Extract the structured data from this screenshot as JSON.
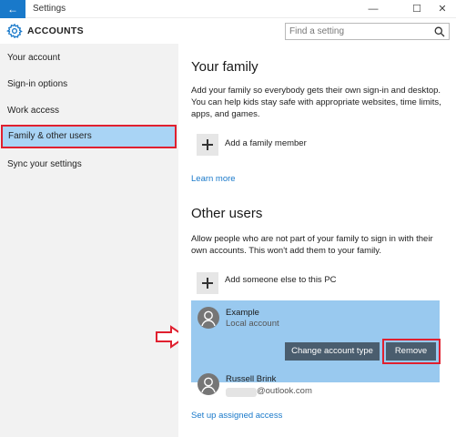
{
  "window": {
    "title": "Settings",
    "back_glyph": "←",
    "minimize_glyph": "—",
    "maximize_glyph": "☐",
    "close_glyph": "✕"
  },
  "header": {
    "title": "ACCOUNTS",
    "icon": "gear-icon"
  },
  "search": {
    "placeholder": "Find a setting",
    "icon": "search-icon"
  },
  "sidebar": {
    "items": [
      {
        "label": "Your account",
        "active": false
      },
      {
        "label": "Sign-in options",
        "active": false
      },
      {
        "label": "Work access",
        "active": false
      },
      {
        "label": "Family & other users",
        "active": true
      },
      {
        "label": "Sync your settings",
        "active": false
      }
    ]
  },
  "family": {
    "heading": "Your family",
    "description": "Add your family so everybody gets their own sign-in and desktop. You can help kids stay safe with appropriate websites, time limits, apps, and games.",
    "add_label": "Add a family member",
    "learn_more": "Learn more"
  },
  "other_users": {
    "heading": "Other users",
    "description": "Allow people who are not part of your family to sign in with their own accounts. This won't add them to your family.",
    "add_label": "Add someone else to this PC",
    "users": [
      {
        "name": "Example",
        "subtitle": "Local account"
      },
      {
        "name": "Russell Brink",
        "subtitle": "@outlook.com"
      }
    ],
    "change_type_button": "Change account type",
    "remove_button": "Remove",
    "assigned_access_link": "Set up assigned access"
  },
  "colors": {
    "accent": "#1979ca",
    "selected_row": "#99c9ef",
    "sidebar_active": "#a9d4f5",
    "highlight_red": "#e0202f",
    "button": "#4a5d6e"
  }
}
